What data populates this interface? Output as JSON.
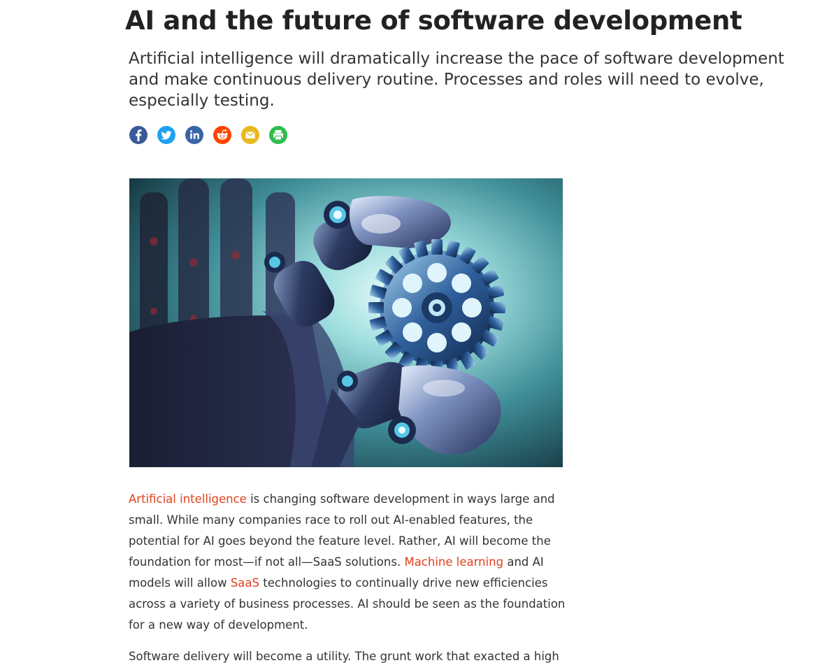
{
  "article": {
    "title": "AI and the future of software development",
    "dek": "Artificial intelligence will dramatically increase the pace of software development and make continuous delivery routine. Processes and roles will need to evolve, especially testing."
  },
  "share": {
    "buttons": [
      {
        "name": "facebook",
        "icon": "facebook-icon",
        "color": "#3b5998"
      },
      {
        "name": "twitter",
        "icon": "twitter-icon",
        "color": "#1da1f2"
      },
      {
        "name": "linkedin",
        "icon": "linkedin-icon",
        "color": "#3866a6"
      },
      {
        "name": "reddit",
        "icon": "reddit-icon",
        "color": "#ff4500"
      },
      {
        "name": "email",
        "icon": "email-icon",
        "color": "#e8b820"
      },
      {
        "name": "print",
        "icon": "print-icon",
        "color": "#2dbd4e"
      }
    ]
  },
  "hero": {
    "image": "robot-hand-holding-gear"
  },
  "body": {
    "p1": {
      "link1": "Artificial intelligence",
      "text1": " is changing software development in ways large and small. While many companies race to roll out AI-enabled features, the potential for AI goes beyond the feature level. Rather, AI will become the foundation for most—if not all—SaaS solutions. ",
      "link2": "Machine learning",
      "text2": " and AI models will allow ",
      "link3": "SaaS",
      "text3": " technologies to continually drive new efficiencies across a variety of business processes. AI should be seen as the foundation for a new way of development."
    },
    "p2": "Software delivery will become a utility. The grunt work that exacted a high"
  },
  "colors": {
    "link": "#e2401c",
    "text": "#333333",
    "headline": "#222222"
  }
}
